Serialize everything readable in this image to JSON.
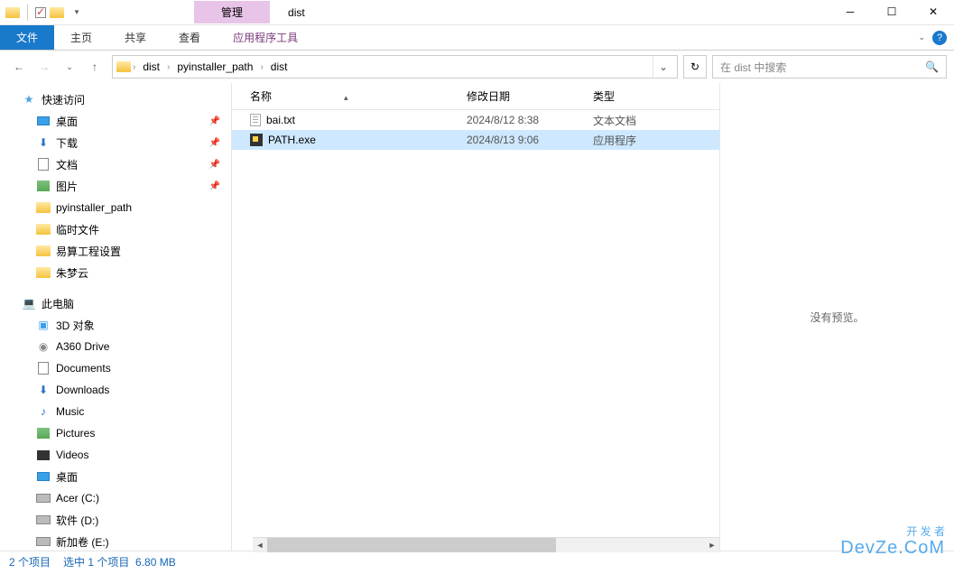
{
  "title_bar": {
    "manage_tab": "管理",
    "window_title": "dist"
  },
  "ribbon": {
    "file": "文件",
    "home": "主页",
    "share": "共享",
    "view": "查看",
    "app_tools": "应用程序工具"
  },
  "address": {
    "segments": [
      "dist",
      "pyinstaller_path",
      "dist"
    ],
    "search_placeholder": "在 dist 中搜索"
  },
  "sidebar": {
    "quick_access": "快速访问",
    "items_pinned": [
      {
        "label": "桌面",
        "icon": "desktop"
      },
      {
        "label": "下载",
        "icon": "download"
      },
      {
        "label": "文档",
        "icon": "doc"
      },
      {
        "label": "图片",
        "icon": "img"
      }
    ],
    "items_folders": [
      {
        "label": "pyinstaller_path"
      },
      {
        "label": "临时文件"
      },
      {
        "label": "易算工程设置"
      },
      {
        "label": "朱梦云"
      }
    ],
    "this_pc": "此电脑",
    "pc_items": [
      {
        "label": "3D 对象",
        "icon": "3d"
      },
      {
        "label": "A360 Drive",
        "icon": "drive-a"
      },
      {
        "label": "Documents",
        "icon": "doc"
      },
      {
        "label": "Downloads",
        "icon": "download"
      },
      {
        "label": "Music",
        "icon": "music"
      },
      {
        "label": "Pictures",
        "icon": "img"
      },
      {
        "label": "Videos",
        "icon": "video"
      },
      {
        "label": "桌面",
        "icon": "desktop"
      },
      {
        "label": "Acer (C:)",
        "icon": "drive"
      },
      {
        "label": "软件 (D:)",
        "icon": "drive"
      },
      {
        "label": "新加卷 (E:)",
        "icon": "drive"
      }
    ]
  },
  "columns": {
    "name": "名称",
    "date": "修改日期",
    "type": "类型"
  },
  "files": [
    {
      "name": "bai.txt",
      "date": "2024/8/12 8:38",
      "type": "文本文档",
      "icon": "txt",
      "selected": false
    },
    {
      "name": "PATH.exe",
      "date": "2024/8/13 9:06",
      "type": "应用程序",
      "icon": "exe",
      "selected": true
    }
  ],
  "preview": {
    "no_preview": "没有预览。"
  },
  "status": {
    "items": "2 个项目",
    "selected": "选中 1 个项目",
    "size": "6.80 MB"
  },
  "watermark": {
    "line1": "开 发 者",
    "line2": "DevZe.CoM"
  }
}
